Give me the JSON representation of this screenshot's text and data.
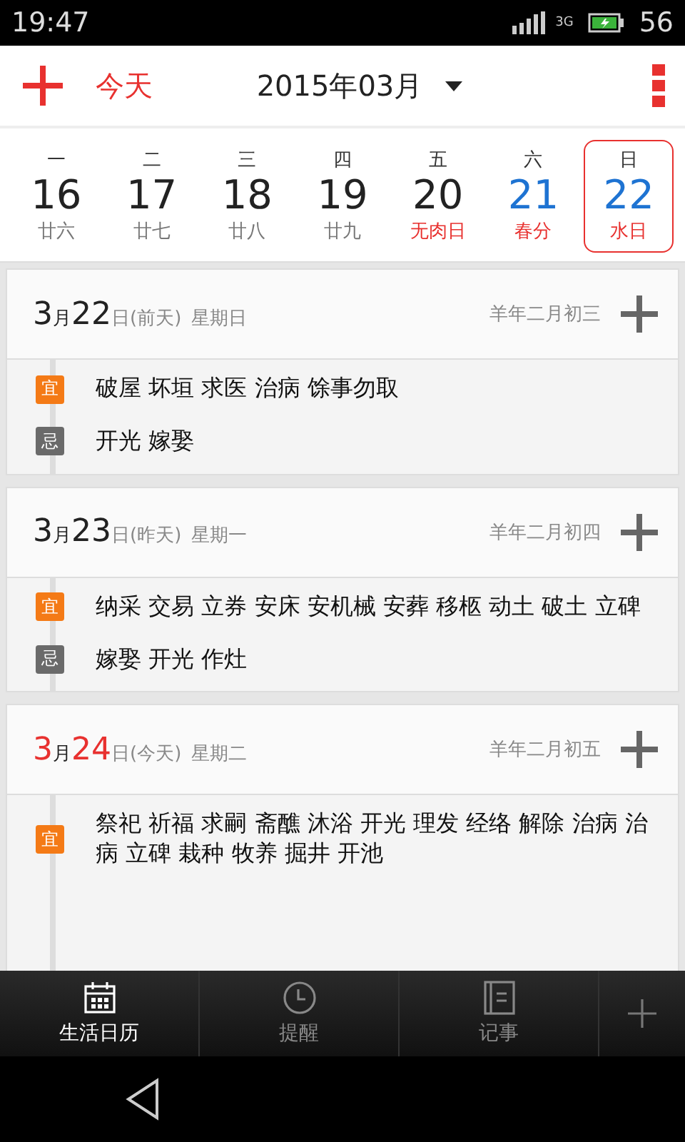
{
  "status_bar": {
    "time": "19:47",
    "network": "3G",
    "battery": "56"
  },
  "toolbar": {
    "today_button": "今天",
    "title": "2015年03月"
  },
  "week": [
    {
      "weekday": "一",
      "day": "16",
      "lunar": "廿六",
      "weekend": false,
      "festival": false,
      "selected": false
    },
    {
      "weekday": "二",
      "day": "17",
      "lunar": "廿七",
      "weekend": false,
      "festival": false,
      "selected": false
    },
    {
      "weekday": "三",
      "day": "18",
      "lunar": "廿八",
      "weekend": false,
      "festival": false,
      "selected": false
    },
    {
      "weekday": "四",
      "day": "19",
      "lunar": "廿九",
      "weekend": false,
      "festival": false,
      "selected": false
    },
    {
      "weekday": "五",
      "day": "20",
      "lunar": "无肉日",
      "weekend": false,
      "festival": true,
      "selected": false
    },
    {
      "weekday": "六",
      "day": "21",
      "lunar": "春分",
      "weekend": true,
      "festival": true,
      "selected": false
    },
    {
      "weekday": "日",
      "day": "22",
      "lunar": "水日",
      "weekend": true,
      "festival": true,
      "selected": true
    }
  ],
  "days": [
    {
      "month": "3",
      "month_suffix": "月",
      "day": "22",
      "day_suffix": "日",
      "relative": "(前天)",
      "weekday": "星期日",
      "lunar_date": "羊年二月初三",
      "today": false,
      "almanac": [
        {
          "kind": "yi",
          "badge": "宜",
          "text": "破屋 坏垣 求医 治病 馀事勿取"
        },
        {
          "kind": "ji",
          "badge": "忌",
          "text": "开光 嫁娶"
        }
      ]
    },
    {
      "month": "3",
      "month_suffix": "月",
      "day": "23",
      "day_suffix": "日",
      "relative": "(昨天)",
      "weekday": "星期一",
      "lunar_date": "羊年二月初四",
      "today": false,
      "almanac": [
        {
          "kind": "yi",
          "badge": "宜",
          "text": "纳采 交易 立券 安床 安机械 安葬 移柩 动土 破土 立碑"
        },
        {
          "kind": "ji",
          "badge": "忌",
          "text": "嫁娶 开光 作灶"
        }
      ]
    },
    {
      "month": "3",
      "month_suffix": "月",
      "day": "24",
      "day_suffix": "日",
      "relative": "(今天)",
      "weekday": "星期二",
      "lunar_date": "羊年二月初五",
      "today": true,
      "almanac": [
        {
          "kind": "yi",
          "badge": "宜",
          "text": "祭祀 祈福 求嗣 斋醮 沐浴 开光 理发 经络 解除 治病 治病 立碑 栽种 牧养 掘井 开池"
        }
      ]
    }
  ],
  "tabs": [
    {
      "label": "生活日历",
      "kind": "calendar",
      "selected": true
    },
    {
      "label": "提醒",
      "kind": "reminder",
      "selected": false
    },
    {
      "label": "记事",
      "kind": "notes",
      "selected": false
    }
  ]
}
